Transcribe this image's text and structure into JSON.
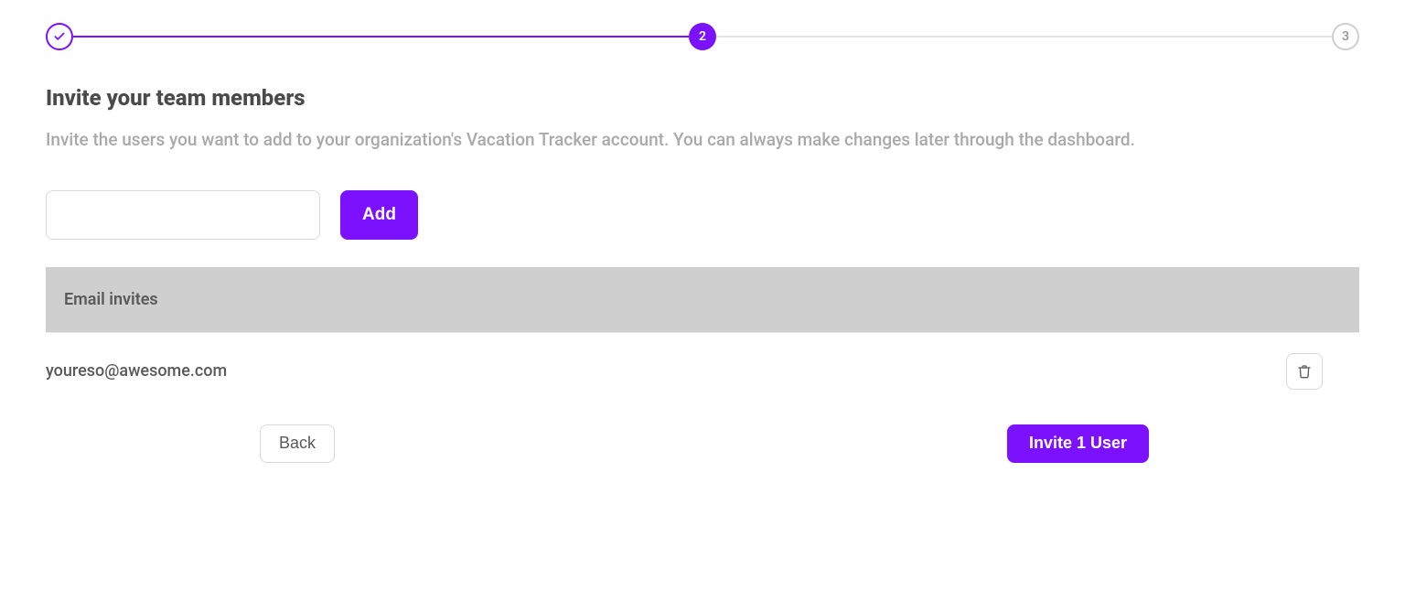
{
  "stepper": {
    "step2": "2",
    "step3": "3"
  },
  "heading": "Invite your team members",
  "subheading": "Invite the users you want to add to your organization's Vacation Tracker account. You can always make changes later through the dashboard.",
  "input": {
    "value": "",
    "add_label": "Add"
  },
  "table": {
    "header": "Email invites",
    "rows": [
      {
        "email": "youreso@awesome.com"
      }
    ]
  },
  "actions": {
    "back_label": "Back",
    "invite_label": "Invite 1 User"
  }
}
